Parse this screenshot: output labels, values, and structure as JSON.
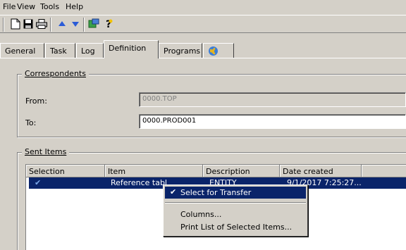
{
  "menu": [
    "File",
    "View",
    "Tools",
    "Help"
  ],
  "toolbar": {
    "icons": [
      "new-document-icon",
      "save-icon",
      "print-icon",
      "arrow-up-icon",
      "arrow-down-icon",
      "transfer-icon",
      "help-icon"
    ]
  },
  "tabs": [
    {
      "label": "General"
    },
    {
      "label": "Task"
    },
    {
      "label": "Log"
    },
    {
      "label": "Definition",
      "active": true
    },
    {
      "label": "Programs"
    },
    {
      "label": "",
      "icon": "globe-icon"
    }
  ],
  "correspondents": {
    "group_label": "Correspondents",
    "from_label": "From:",
    "from_value": "0000.TOP",
    "to_label": "To:",
    "to_value": "0000.PROD001"
  },
  "sent_items": {
    "group_label": "Sent Items",
    "columns": [
      "Selection",
      "Item",
      "Description",
      "Date created"
    ],
    "rows": [
      {
        "selection": "✔",
        "item": "Reference tabl",
        "description": "ENTITY",
        "date_created": "9/1/2017 7:25:27..."
      }
    ]
  },
  "context_menu": {
    "items": [
      {
        "label": "Select for Transfer",
        "checked": true,
        "highlighted": true
      },
      {
        "label": "Columns..."
      },
      {
        "label": "Print List of Selected Items..."
      }
    ]
  },
  "colors": {
    "selection": "#0a246a",
    "face": "#d4d0c8"
  }
}
